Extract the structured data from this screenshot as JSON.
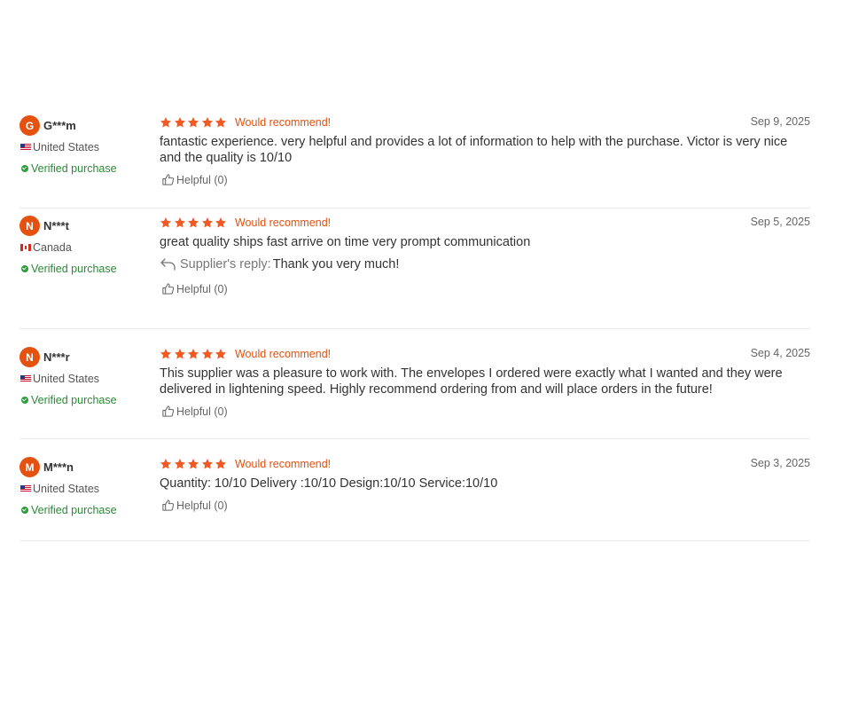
{
  "colors": {
    "accent": "#e5510e",
    "star": "#f15a24",
    "verified": "#2b8a37",
    "divider": "#e8e8e8"
  },
  "reviews": [
    {
      "initial": "G",
      "name": "G***m",
      "country": "United States",
      "flag": "us-flag-icon",
      "verified": "Verified purchase",
      "rating": 5,
      "recommend": "Would recommend!",
      "date": "Sep 9, 2025",
      "text": "fantastic experience. very helpful and provides a lot of information to help with the purchase. Victor is very nice and the quality is 10/10",
      "helpful": "Helpful (0)"
    },
    {
      "initial": "N",
      "name": "N***t",
      "country": "Canada",
      "flag": "canada-flag-icon",
      "verified": "Verified purchase",
      "rating": 5,
      "recommend": "Would recommend!",
      "date": "Sep 5, 2025",
      "text": "great quality ships fast arrive on time very prompt communication",
      "reply_label": "Supplier's reply:",
      "reply_text": "Thank you very much!",
      "helpful": "Helpful (0)"
    },
    {
      "initial": "N",
      "name": "N***r",
      "country": "United States",
      "flag": "us-flag-icon",
      "verified": "Verified purchase",
      "rating": 5,
      "recommend": "Would recommend!",
      "date": "Sep 4, 2025",
      "text": "This supplier was a pleasure to work with. The envelopes I ordered were exactly what I wanted and they were delivered in lightening speed. Highly recommend ordering from and will place orders in the future!",
      "helpful": "Helpful (0)"
    },
    {
      "initial": "M",
      "name": "M***n",
      "country": "United States",
      "flag": "us-flag-icon",
      "verified": "Verified purchase",
      "rating": 5,
      "recommend": "Would recommend!",
      "date": "Sep 3, 2025",
      "text": "Quantity: 10/10 Delivery :10/10 Design:10/10 Service:10/10",
      "helpful": "Helpful (0)"
    }
  ]
}
